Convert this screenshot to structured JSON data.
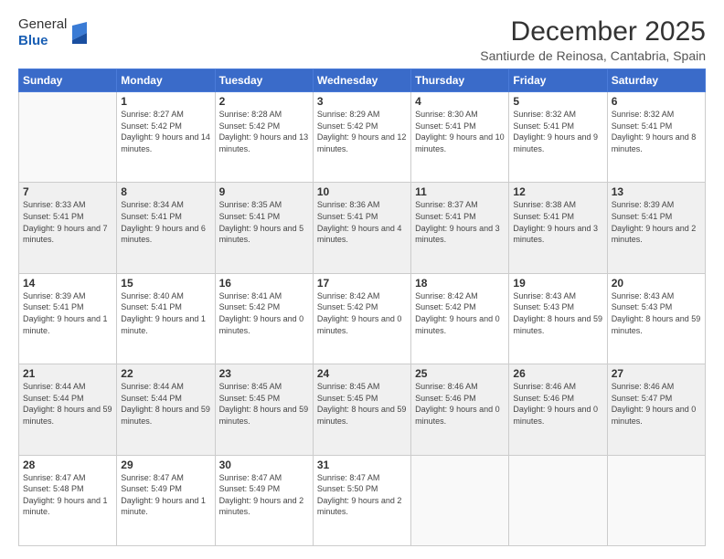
{
  "logo": {
    "general": "General",
    "blue": "Blue"
  },
  "title": "December 2025",
  "subtitle": "Santiurde de Reinosa, Cantabria, Spain",
  "days_header": [
    "Sunday",
    "Monday",
    "Tuesday",
    "Wednesday",
    "Thursday",
    "Friday",
    "Saturday"
  ],
  "weeks": [
    [
      {
        "num": "",
        "sunrise": "",
        "sunset": "",
        "daylight": ""
      },
      {
        "num": "1",
        "sunrise": "Sunrise: 8:27 AM",
        "sunset": "Sunset: 5:42 PM",
        "daylight": "Daylight: 9 hours and 14 minutes."
      },
      {
        "num": "2",
        "sunrise": "Sunrise: 8:28 AM",
        "sunset": "Sunset: 5:42 PM",
        "daylight": "Daylight: 9 hours and 13 minutes."
      },
      {
        "num": "3",
        "sunrise": "Sunrise: 8:29 AM",
        "sunset": "Sunset: 5:42 PM",
        "daylight": "Daylight: 9 hours and 12 minutes."
      },
      {
        "num": "4",
        "sunrise": "Sunrise: 8:30 AM",
        "sunset": "Sunset: 5:41 PM",
        "daylight": "Daylight: 9 hours and 10 minutes."
      },
      {
        "num": "5",
        "sunrise": "Sunrise: 8:32 AM",
        "sunset": "Sunset: 5:41 PM",
        "daylight": "Daylight: 9 hours and 9 minutes."
      },
      {
        "num": "6",
        "sunrise": "Sunrise: 8:32 AM",
        "sunset": "Sunset: 5:41 PM",
        "daylight": "Daylight: 9 hours and 8 minutes."
      }
    ],
    [
      {
        "num": "7",
        "sunrise": "Sunrise: 8:33 AM",
        "sunset": "Sunset: 5:41 PM",
        "daylight": "Daylight: 9 hours and 7 minutes."
      },
      {
        "num": "8",
        "sunrise": "Sunrise: 8:34 AM",
        "sunset": "Sunset: 5:41 PM",
        "daylight": "Daylight: 9 hours and 6 minutes."
      },
      {
        "num": "9",
        "sunrise": "Sunrise: 8:35 AM",
        "sunset": "Sunset: 5:41 PM",
        "daylight": "Daylight: 9 hours and 5 minutes."
      },
      {
        "num": "10",
        "sunrise": "Sunrise: 8:36 AM",
        "sunset": "Sunset: 5:41 PM",
        "daylight": "Daylight: 9 hours and 4 minutes."
      },
      {
        "num": "11",
        "sunrise": "Sunrise: 8:37 AM",
        "sunset": "Sunset: 5:41 PM",
        "daylight": "Daylight: 9 hours and 3 minutes."
      },
      {
        "num": "12",
        "sunrise": "Sunrise: 8:38 AM",
        "sunset": "Sunset: 5:41 PM",
        "daylight": "Daylight: 9 hours and 3 minutes."
      },
      {
        "num": "13",
        "sunrise": "Sunrise: 8:39 AM",
        "sunset": "Sunset: 5:41 PM",
        "daylight": "Daylight: 9 hours and 2 minutes."
      }
    ],
    [
      {
        "num": "14",
        "sunrise": "Sunrise: 8:39 AM",
        "sunset": "Sunset: 5:41 PM",
        "daylight": "Daylight: 9 hours and 1 minute."
      },
      {
        "num": "15",
        "sunrise": "Sunrise: 8:40 AM",
        "sunset": "Sunset: 5:41 PM",
        "daylight": "Daylight: 9 hours and 1 minute."
      },
      {
        "num": "16",
        "sunrise": "Sunrise: 8:41 AM",
        "sunset": "Sunset: 5:42 PM",
        "daylight": "Daylight: 9 hours and 0 minutes."
      },
      {
        "num": "17",
        "sunrise": "Sunrise: 8:42 AM",
        "sunset": "Sunset: 5:42 PM",
        "daylight": "Daylight: 9 hours and 0 minutes."
      },
      {
        "num": "18",
        "sunrise": "Sunrise: 8:42 AM",
        "sunset": "Sunset: 5:42 PM",
        "daylight": "Daylight: 9 hours and 0 minutes."
      },
      {
        "num": "19",
        "sunrise": "Sunrise: 8:43 AM",
        "sunset": "Sunset: 5:43 PM",
        "daylight": "Daylight: 8 hours and 59 minutes."
      },
      {
        "num": "20",
        "sunrise": "Sunrise: 8:43 AM",
        "sunset": "Sunset: 5:43 PM",
        "daylight": "Daylight: 8 hours and 59 minutes."
      }
    ],
    [
      {
        "num": "21",
        "sunrise": "Sunrise: 8:44 AM",
        "sunset": "Sunset: 5:44 PM",
        "daylight": "Daylight: 8 hours and 59 minutes."
      },
      {
        "num": "22",
        "sunrise": "Sunrise: 8:44 AM",
        "sunset": "Sunset: 5:44 PM",
        "daylight": "Daylight: 8 hours and 59 minutes."
      },
      {
        "num": "23",
        "sunrise": "Sunrise: 8:45 AM",
        "sunset": "Sunset: 5:45 PM",
        "daylight": "Daylight: 8 hours and 59 minutes."
      },
      {
        "num": "24",
        "sunrise": "Sunrise: 8:45 AM",
        "sunset": "Sunset: 5:45 PM",
        "daylight": "Daylight: 8 hours and 59 minutes."
      },
      {
        "num": "25",
        "sunrise": "Sunrise: 8:46 AM",
        "sunset": "Sunset: 5:46 PM",
        "daylight": "Daylight: 9 hours and 0 minutes."
      },
      {
        "num": "26",
        "sunrise": "Sunrise: 8:46 AM",
        "sunset": "Sunset: 5:46 PM",
        "daylight": "Daylight: 9 hours and 0 minutes."
      },
      {
        "num": "27",
        "sunrise": "Sunrise: 8:46 AM",
        "sunset": "Sunset: 5:47 PM",
        "daylight": "Daylight: 9 hours and 0 minutes."
      }
    ],
    [
      {
        "num": "28",
        "sunrise": "Sunrise: 8:47 AM",
        "sunset": "Sunset: 5:48 PM",
        "daylight": "Daylight: 9 hours and 1 minute."
      },
      {
        "num": "29",
        "sunrise": "Sunrise: 8:47 AM",
        "sunset": "Sunset: 5:49 PM",
        "daylight": "Daylight: 9 hours and 1 minute."
      },
      {
        "num": "30",
        "sunrise": "Sunrise: 8:47 AM",
        "sunset": "Sunset: 5:49 PM",
        "daylight": "Daylight: 9 hours and 2 minutes."
      },
      {
        "num": "31",
        "sunrise": "Sunrise: 8:47 AM",
        "sunset": "Sunset: 5:50 PM",
        "daylight": "Daylight: 9 hours and 2 minutes."
      },
      {
        "num": "",
        "sunrise": "",
        "sunset": "",
        "daylight": ""
      },
      {
        "num": "",
        "sunrise": "",
        "sunset": "",
        "daylight": ""
      },
      {
        "num": "",
        "sunrise": "",
        "sunset": "",
        "daylight": ""
      }
    ]
  ]
}
